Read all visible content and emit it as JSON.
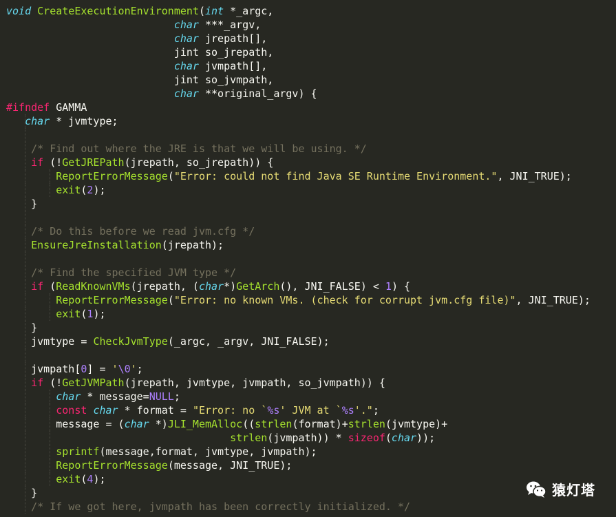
{
  "editor": {
    "language": "C",
    "theme_colors": {
      "background": "#272822",
      "plain": "#f8f8f2",
      "keyword": "#f92672",
      "type": "#66d9ef",
      "function": "#a6e22e",
      "string": "#e6db74",
      "number": "#ae81ff",
      "comment": "#75715e"
    },
    "lines": [
      {
        "indent": 0,
        "tokens": [
          {
            "t": "type",
            "v": "void"
          },
          {
            "t": "plain",
            "v": " "
          },
          {
            "t": "function",
            "v": "CreateExecutionEnvironment"
          },
          {
            "t": "plain",
            "v": "("
          },
          {
            "t": "type",
            "v": "int"
          },
          {
            "t": "plain",
            "v": " *_argc,"
          }
        ]
      },
      {
        "indent": 0,
        "tokens": [
          {
            "t": "plain",
            "v": "                           "
          },
          {
            "t": "type",
            "v": "char"
          },
          {
            "t": "plain",
            "v": " ***_argv,"
          }
        ]
      },
      {
        "indent": 0,
        "tokens": [
          {
            "t": "plain",
            "v": "                           "
          },
          {
            "t": "type",
            "v": "char"
          },
          {
            "t": "plain",
            "v": " jrepath[],"
          }
        ]
      },
      {
        "indent": 0,
        "tokens": [
          {
            "t": "plain",
            "v": "                           jint so_jrepath,"
          }
        ]
      },
      {
        "indent": 0,
        "tokens": [
          {
            "t": "plain",
            "v": "                           "
          },
          {
            "t": "type",
            "v": "char"
          },
          {
            "t": "plain",
            "v": " jvmpath[],"
          }
        ]
      },
      {
        "indent": 0,
        "tokens": [
          {
            "t": "plain",
            "v": "                           jint so_jvmpath,"
          }
        ]
      },
      {
        "indent": 0,
        "tokens": [
          {
            "t": "plain",
            "v": "                           "
          },
          {
            "t": "type",
            "v": "char"
          },
          {
            "t": "plain",
            "v": " **original_argv) {"
          }
        ]
      },
      {
        "indent": 0,
        "tokens": [
          {
            "t": "directive",
            "v": "#ifndef"
          },
          {
            "t": "plain",
            "v": " GAMMA"
          }
        ]
      },
      {
        "indent": 1,
        "tokens": [
          {
            "t": "plain",
            "v": "   "
          },
          {
            "t": "type",
            "v": "char"
          },
          {
            "t": "plain",
            "v": " * jvmtype;"
          }
        ]
      },
      {
        "indent": 1,
        "tokens": []
      },
      {
        "indent": 1,
        "tokens": [
          {
            "t": "plain",
            "v": "    "
          },
          {
            "t": "comment",
            "v": "/* Find out where the JRE is that we will be using. */"
          }
        ]
      },
      {
        "indent": 1,
        "tokens": [
          {
            "t": "plain",
            "v": "    "
          },
          {
            "t": "keyword",
            "v": "if"
          },
          {
            "t": "plain",
            "v": " (!"
          },
          {
            "t": "function",
            "v": "GetJREPath"
          },
          {
            "t": "plain",
            "v": "(jrepath, so_jrepath)) {"
          }
        ]
      },
      {
        "indent": 2,
        "tokens": [
          {
            "t": "plain",
            "v": "        "
          },
          {
            "t": "function",
            "v": "ReportErrorMessage"
          },
          {
            "t": "plain",
            "v": "("
          },
          {
            "t": "string",
            "v": "\"Error: could not find Java SE Runtime Environment.\""
          },
          {
            "t": "plain",
            "v": ", JNI_TRUE);"
          }
        ]
      },
      {
        "indent": 2,
        "tokens": [
          {
            "t": "plain",
            "v": "        "
          },
          {
            "t": "function",
            "v": "exit"
          },
          {
            "t": "plain",
            "v": "("
          },
          {
            "t": "number",
            "v": "2"
          },
          {
            "t": "plain",
            "v": ");"
          }
        ]
      },
      {
        "indent": 1,
        "tokens": [
          {
            "t": "plain",
            "v": "    }"
          }
        ]
      },
      {
        "indent": 1,
        "tokens": []
      },
      {
        "indent": 1,
        "tokens": [
          {
            "t": "plain",
            "v": "    "
          },
          {
            "t": "comment",
            "v": "/* Do this before we read jvm.cfg */"
          }
        ]
      },
      {
        "indent": 1,
        "tokens": [
          {
            "t": "plain",
            "v": "    "
          },
          {
            "t": "function",
            "v": "EnsureJreInstallation"
          },
          {
            "t": "plain",
            "v": "(jrepath);"
          }
        ]
      },
      {
        "indent": 1,
        "tokens": []
      },
      {
        "indent": 1,
        "tokens": [
          {
            "t": "plain",
            "v": "    "
          },
          {
            "t": "comment",
            "v": "/* Find the specified JVM type */"
          }
        ]
      },
      {
        "indent": 1,
        "tokens": [
          {
            "t": "plain",
            "v": "    "
          },
          {
            "t": "keyword",
            "v": "if"
          },
          {
            "t": "plain",
            "v": " ("
          },
          {
            "t": "function",
            "v": "ReadKnownVMs"
          },
          {
            "t": "plain",
            "v": "(jrepath, ("
          },
          {
            "t": "type",
            "v": "char"
          },
          {
            "t": "plain",
            "v": "*)"
          },
          {
            "t": "function",
            "v": "GetArch"
          },
          {
            "t": "plain",
            "v": "(), JNI_FALSE) < "
          },
          {
            "t": "number",
            "v": "1"
          },
          {
            "t": "plain",
            "v": ") {"
          }
        ]
      },
      {
        "indent": 2,
        "tokens": [
          {
            "t": "plain",
            "v": "        "
          },
          {
            "t": "function",
            "v": "ReportErrorMessage"
          },
          {
            "t": "plain",
            "v": "("
          },
          {
            "t": "string",
            "v": "\"Error: no known VMs. (check for corrupt jvm.cfg file)\""
          },
          {
            "t": "plain",
            "v": ", JNI_TRUE);"
          }
        ]
      },
      {
        "indent": 2,
        "tokens": [
          {
            "t": "plain",
            "v": "        "
          },
          {
            "t": "function",
            "v": "exit"
          },
          {
            "t": "plain",
            "v": "("
          },
          {
            "t": "number",
            "v": "1"
          },
          {
            "t": "plain",
            "v": ");"
          }
        ]
      },
      {
        "indent": 1,
        "tokens": [
          {
            "t": "plain",
            "v": "    }"
          }
        ]
      },
      {
        "indent": 1,
        "tokens": [
          {
            "t": "plain",
            "v": "    jvmtype = "
          },
          {
            "t": "function",
            "v": "CheckJvmType"
          },
          {
            "t": "plain",
            "v": "(_argc, _argv, JNI_FALSE);"
          }
        ]
      },
      {
        "indent": 1,
        "tokens": []
      },
      {
        "indent": 1,
        "tokens": [
          {
            "t": "plain",
            "v": "    jvmpath["
          },
          {
            "t": "number",
            "v": "0"
          },
          {
            "t": "plain",
            "v": "] = "
          },
          {
            "t": "string",
            "v": "'"
          },
          {
            "t": "escape",
            "v": "\\0"
          },
          {
            "t": "string",
            "v": "'"
          },
          {
            "t": "plain",
            "v": ";"
          }
        ]
      },
      {
        "indent": 1,
        "tokens": [
          {
            "t": "plain",
            "v": "    "
          },
          {
            "t": "keyword",
            "v": "if"
          },
          {
            "t": "plain",
            "v": " (!"
          },
          {
            "t": "function",
            "v": "GetJVMPath"
          },
          {
            "t": "plain",
            "v": "(jrepath, jvmtype, jvmpath, so_jvmpath)) {"
          }
        ]
      },
      {
        "indent": 2,
        "tokens": [
          {
            "t": "plain",
            "v": "        "
          },
          {
            "t": "type",
            "v": "char"
          },
          {
            "t": "plain",
            "v": " * message="
          },
          {
            "t": "number",
            "v": "NULL"
          },
          {
            "t": "plain",
            "v": ";"
          }
        ]
      },
      {
        "indent": 2,
        "tokens": [
          {
            "t": "plain",
            "v": "        "
          },
          {
            "t": "keyword",
            "v": "const"
          },
          {
            "t": "plain",
            "v": " "
          },
          {
            "t": "type",
            "v": "char"
          },
          {
            "t": "plain",
            "v": " * format = "
          },
          {
            "t": "string",
            "v": "\"Error: no `"
          },
          {
            "t": "escape",
            "v": "%s"
          },
          {
            "t": "string",
            "v": "' JVM at `"
          },
          {
            "t": "escape",
            "v": "%s"
          },
          {
            "t": "string",
            "v": "'.\""
          },
          {
            "t": "plain",
            "v": ";"
          }
        ]
      },
      {
        "indent": 2,
        "tokens": [
          {
            "t": "plain",
            "v": "        message = ("
          },
          {
            "t": "type",
            "v": "char"
          },
          {
            "t": "plain",
            "v": " *)"
          },
          {
            "t": "function",
            "v": "JLI_MemAlloc"
          },
          {
            "t": "plain",
            "v": "(("
          },
          {
            "t": "function",
            "v": "strlen"
          },
          {
            "t": "plain",
            "v": "(format)+"
          },
          {
            "t": "function",
            "v": "strlen"
          },
          {
            "t": "plain",
            "v": "(jvmtype)+"
          }
        ]
      },
      {
        "indent": 2,
        "tokens": [
          {
            "t": "plain",
            "v": "                                    "
          },
          {
            "t": "function",
            "v": "strlen"
          },
          {
            "t": "plain",
            "v": "(jvmpath)) * "
          },
          {
            "t": "keyword",
            "v": "sizeof"
          },
          {
            "t": "plain",
            "v": "("
          },
          {
            "t": "type",
            "v": "char"
          },
          {
            "t": "plain",
            "v": "));"
          }
        ]
      },
      {
        "indent": 2,
        "tokens": [
          {
            "t": "plain",
            "v": "        "
          },
          {
            "t": "function",
            "v": "sprintf"
          },
          {
            "t": "plain",
            "v": "(message,format, jvmtype, jvmpath);"
          }
        ]
      },
      {
        "indent": 2,
        "tokens": [
          {
            "t": "plain",
            "v": "        "
          },
          {
            "t": "function",
            "v": "ReportErrorMessage"
          },
          {
            "t": "plain",
            "v": "(message, JNI_TRUE);"
          }
        ]
      },
      {
        "indent": 2,
        "tokens": [
          {
            "t": "plain",
            "v": "        "
          },
          {
            "t": "function",
            "v": "exit"
          },
          {
            "t": "plain",
            "v": "("
          },
          {
            "t": "number",
            "v": "4"
          },
          {
            "t": "plain",
            "v": ");"
          }
        ]
      },
      {
        "indent": 1,
        "tokens": [
          {
            "t": "plain",
            "v": "    }"
          }
        ]
      },
      {
        "indent": 1,
        "tokens": [
          {
            "t": "plain",
            "v": "    "
          },
          {
            "t": "comment",
            "v": "/* If we got here, jvmpath has been correctly initialized. */"
          }
        ]
      }
    ]
  },
  "watermark": {
    "icon": "wechat-icon",
    "text": "猿灯塔"
  }
}
